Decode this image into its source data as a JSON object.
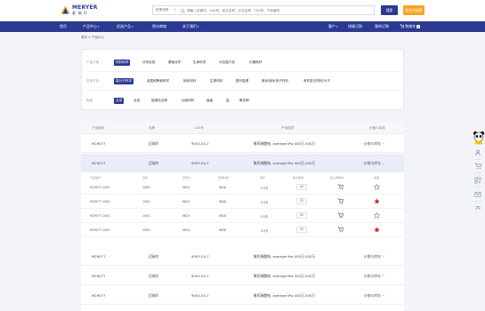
{
  "header": {
    "brand": "MERYER",
    "brand_cn": "麦 瑞 尔",
    "search_category": "化学试剂",
    "search_placeholder": "请输入关键词、CAS号、英文名称、中文名称、CAS号、产品编号",
    "search_button": "搜索",
    "advanced_button": "结构式搜索"
  },
  "nav": {
    "items": [
      "首页",
      "产品中心",
      "优选产品",
      "积分商城",
      "关于我们"
    ],
    "right_items": [
      "客户",
      "快捷订购",
      "我的订购"
    ],
    "cart_label": "购物车",
    "cart_count": "0"
  },
  "breadcrumb": "首页 > 产品中心",
  "filters": {
    "rows": [
      {
        "label": "产品分类",
        "options": [
          {
            "label": "材料科学",
            "active": true
          },
          {
            "label": "分析检测",
            "active": false
          },
          {
            "label": "基础化学",
            "active": false
          },
          {
            "label": "生命科学",
            "active": false
          },
          {
            "label": "大包装产品",
            "active": false
          },
          {
            "label": "仪器耗材",
            "active": false
          }
        ]
      },
      {
        "label": "应用方向",
        "options": [
          {
            "label": "高分子科学",
            "active": true
          },
          {
            "label": "金属和陶瓷科学",
            "active": false
          },
          {
            "label": "纳米材料",
            "active": false
          },
          {
            "label": "生物材料",
            "active": false
          },
          {
            "label": "替代能源",
            "active": false
          },
          {
            "label": "微米/纳米电子材料",
            "active": false
          },
          {
            "label": "有机发光材料/分子",
            "active": false
          }
        ]
      },
      {
        "label": "用途",
        "options": [
          {
            "label": "合成",
            "active": true
          },
          {
            "label": "合成",
            "active": false
          },
          {
            "label": "能源化合物",
            "active": false
          },
          {
            "label": "加成材料",
            "active": false
          },
          {
            "label": "高级",
            "active": false
          },
          {
            "label": "盐",
            "active": false
          },
          {
            "label": "氧化物",
            "active": false
          }
        ]
      }
    ]
  },
  "table": {
    "headers": [
      "产品编码",
      "品牌",
      "CAS号",
      "产品描述",
      "价格与库存"
    ],
    "rows": [
      {
        "code": "M29077",
        "brand": "迈瑞尔",
        "cas": "9003-04-7",
        "desc": "聚丙烯酸钠, average Mw 400万-500万",
        "action": "价格与库存",
        "expanded": false
      },
      {
        "code": "M29077",
        "brand": "迈瑞尔",
        "cas": "9003-04-7",
        "desc": "聚丙烯酸钠, average Mw 400万-500万",
        "action": "价格与库存",
        "expanded": true
      },
      {
        "code": "M29077",
        "brand": "迈瑞尔",
        "cas": "9003-04-7",
        "desc": "聚丙烯酸钠, average Mw 400万-500万",
        "action": "价格与库存",
        "expanded": false
      },
      {
        "code": "M29077",
        "brand": "迈瑞尔",
        "cas": "9003-04-7",
        "desc": "聚丙烯酸钠, average Mw 400万-500万",
        "action": "价格与库存",
        "expanded": false
      },
      {
        "code": "M29077",
        "brand": "迈瑞尔",
        "cas": "9003-04-7",
        "desc": "聚丙烯酸钠, average Mw 400万-500万",
        "action": "价格与库存",
        "expanded": false
      }
    ],
    "sub_headers": [
      "产品编号",
      "包装",
      "目录价",
      "促销价格",
      "库存",
      "购买数量",
      "加入购物车",
      "收藏"
    ],
    "sub_rows": [
      {
        "code": "M29077-100G",
        "pack": "100G",
        "list_price": "¥624",
        "sale_price": "¥628",
        "stock": "3-5天",
        "qty": "21",
        "favorited": false
      },
      {
        "code": "M29077-100G",
        "pack": "100G",
        "list_price": "¥624",
        "sale_price": "¥628",
        "stock": "3-5天",
        "qty": "21",
        "favorited": true
      },
      {
        "code": "M29077-100G",
        "pack": "100G",
        "list_price": "¥624",
        "sale_price": "¥628",
        "stock": "3-5天",
        "qty": "21",
        "favorited": false
      },
      {
        "code": "M29077-100G",
        "pack": "100G",
        "list_price": "¥624",
        "sale_price": "¥628",
        "stock": "3-5天",
        "qty": "21",
        "favorited": true
      }
    ]
  },
  "colors": {
    "primary": "#2b3990",
    "accent": "#f6a623",
    "favorite": "#e02020"
  }
}
